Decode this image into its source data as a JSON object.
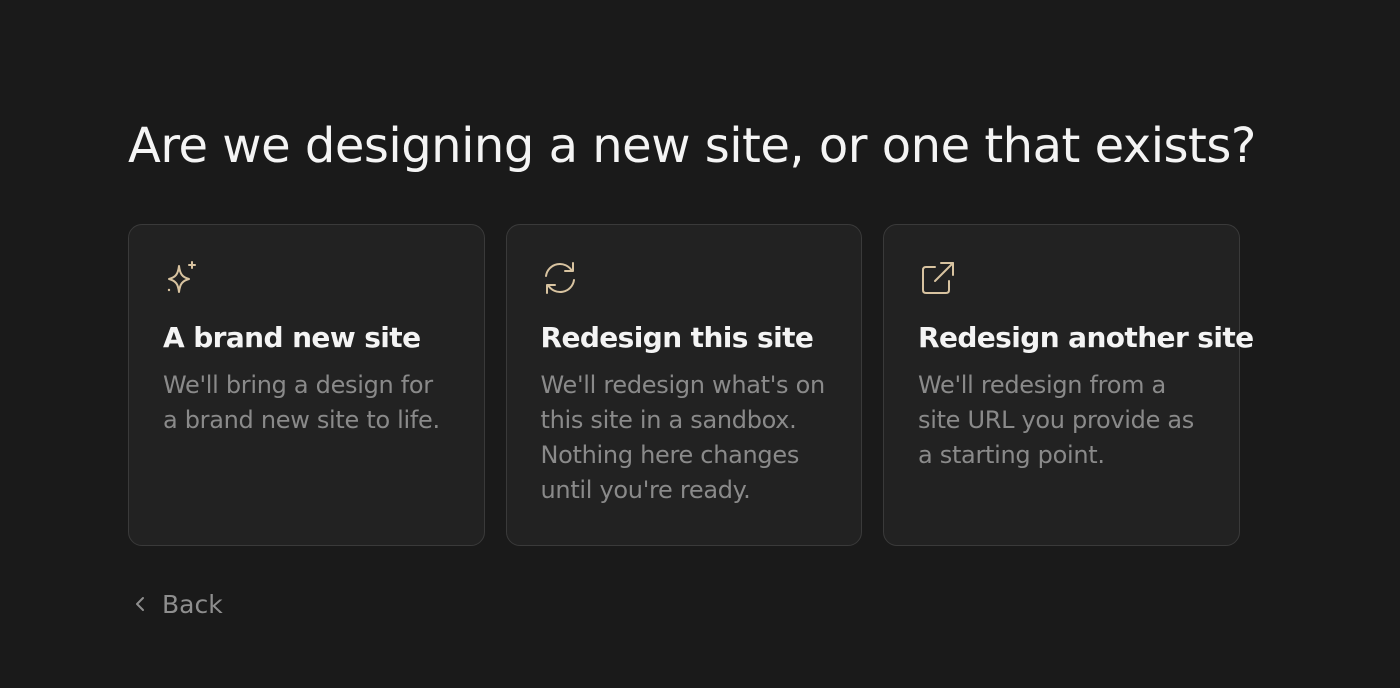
{
  "page": {
    "title": "Are we designing a new site, or one that exists?"
  },
  "options": [
    {
      "icon": "sparkles-icon",
      "title": "A brand new site",
      "description": "We'll bring a design for a brand new site to life."
    },
    {
      "icon": "refresh-icon",
      "title": "Redesign this site",
      "description": "We'll redesign what's on this site in a sandbox. Nothing here changes until you're ready."
    },
    {
      "icon": "external-link-icon",
      "title": "Redesign another site",
      "description": "We'll redesign from a site URL you provide as a starting point."
    }
  ],
  "back": {
    "label": "Back",
    "icon": "chevron-left-icon"
  },
  "colors": {
    "background": "#1a1a1a",
    "card_background": "#222222",
    "card_border": "#3a3a3a",
    "icon_accent": "#d8c3a0",
    "title_text": "#f4f4f4",
    "muted_text": "#8a8a8a"
  }
}
